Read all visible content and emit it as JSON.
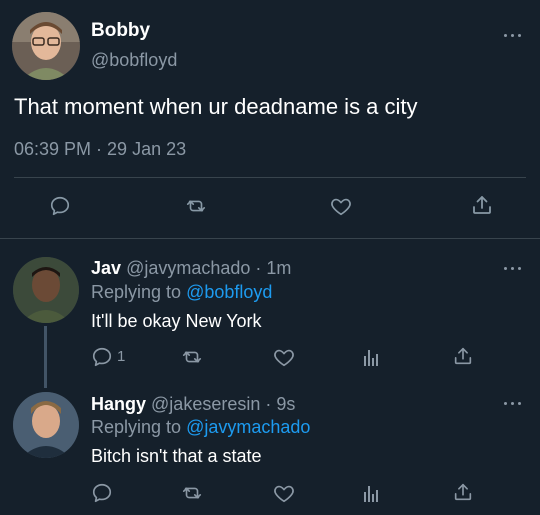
{
  "colors": {
    "background": "#15202b",
    "muted": "#8b98a5",
    "link": "#1d9bf0",
    "divider": "#38444d",
    "icon": "#8b98a5",
    "main_icon": "#8899a6"
  },
  "main_tweet": {
    "display_name": "Bobby",
    "handle": "@bobfloyd",
    "text": "That moment when ur deadname is a city",
    "timestamp": "06:39 PM · 29 Jan 23",
    "actions": [
      "reply-icon",
      "retweet-icon",
      "like-icon",
      "share-icon"
    ]
  },
  "replies": [
    {
      "display_name": "Jav",
      "handle": "@javymachado",
      "time": "· 1m",
      "replying_prefix": "Replying to",
      "replying_to": "@bobfloyd",
      "text": "It'll be okay New York",
      "reply_count": "1",
      "actions": [
        "reply-icon",
        "retweet-icon",
        "like-icon",
        "analytics-icon",
        "share-icon"
      ]
    },
    {
      "display_name": "Hangy",
      "handle": "@jakeseresin",
      "time": "· 9s",
      "replying_prefix": "Replying to",
      "replying_to": "@javymachado",
      "text": "Bitch isn't that a state",
      "reply_count": "",
      "actions": [
        "reply-icon",
        "retweet-icon",
        "like-icon",
        "analytics-icon",
        "share-icon"
      ]
    }
  ]
}
